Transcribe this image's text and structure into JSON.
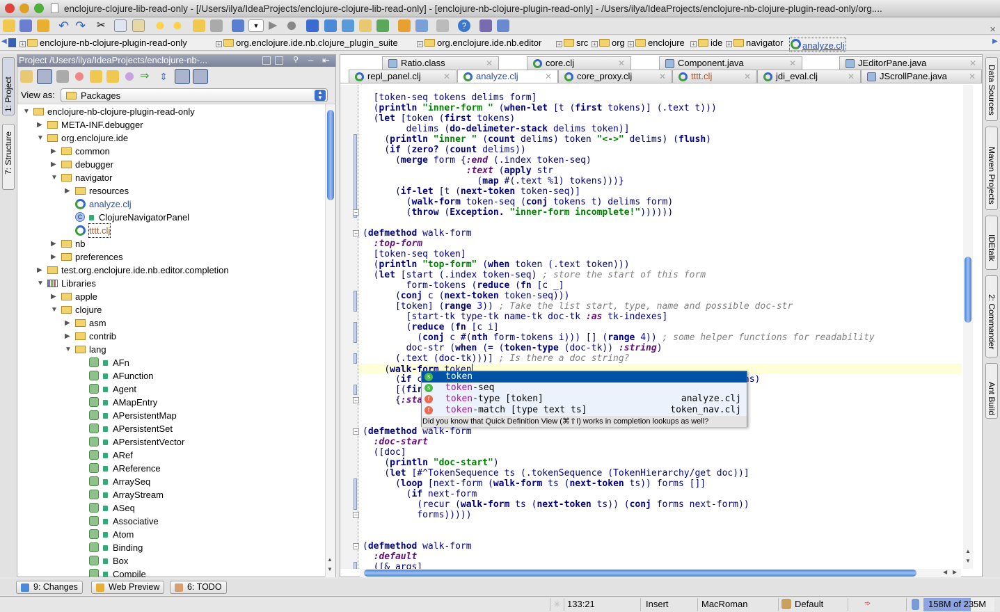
{
  "window": {
    "title": "enclojure-clojure-lib-read-only - [/Users/ilya/IdeaProjects/enclojure-clojure-lib-read-only] - [enclojure-nb-clojure-plugin-read-only] - /Users/ilya/IdeaProjects/enclojure-nb-clojure-plugin-read-only/org...."
  },
  "breadcrumbs": [
    "enclojure-nb-clojure-plugin-read-only",
    "org.enclojure.ide.nb.clojure_plugin_suite",
    "org.enclojure.ide.nb.editor",
    "src",
    "org",
    "enclojure",
    "ide",
    "navigator",
    "analyze.clj"
  ],
  "left_strip": {
    "project": "1: Project",
    "structure": "7: Structure"
  },
  "right_strip": [
    "Data Sources",
    "Maven Projects",
    "IDEtalk",
    "2: Commander",
    "Ant Build"
  ],
  "project": {
    "header": "Project /Users/ilya/IdeaProjects/enclojure-nb-...",
    "view_as_label": "View as:",
    "view_as_value": "Packages",
    "tree": [
      {
        "label": "enclojure-nb-clojure-plugin-read-only",
        "level": 0,
        "state": "expanded",
        "icon": "module-folder-icon"
      },
      {
        "label": "META-INF.debugger",
        "level": 1,
        "state": "collapsed",
        "icon": "package-icon"
      },
      {
        "label": "org.enclojure.ide",
        "level": 1,
        "state": "expanded",
        "icon": "package-icon"
      },
      {
        "label": "common",
        "level": 2,
        "state": "collapsed",
        "icon": "package-icon"
      },
      {
        "label": "debugger",
        "level": 2,
        "state": "collapsed",
        "icon": "package-icon"
      },
      {
        "label": "navigator",
        "level": 2,
        "state": "expanded",
        "icon": "package-icon"
      },
      {
        "label": "resources",
        "level": 3,
        "state": "collapsed",
        "icon": "package-icon"
      },
      {
        "label": "analyze.clj",
        "level": 3,
        "state": "leaf",
        "icon": "clojure-file-icon",
        "color": "#2a4fb0"
      },
      {
        "label": "ClojureNavigatorPanel",
        "level": 3,
        "state": "leaf",
        "icon": "class-icon"
      },
      {
        "label": "tttt.clj",
        "level": 3,
        "state": "leaf",
        "icon": "clojure-file-icon",
        "color": "#b0501a",
        "focused": true
      },
      {
        "label": "nb",
        "level": 2,
        "state": "collapsed",
        "icon": "package-icon"
      },
      {
        "label": "preferences",
        "level": 2,
        "state": "collapsed",
        "icon": "package-icon"
      },
      {
        "label": "test.org.enclojure.ide.nb.editor.completion",
        "level": 1,
        "state": "collapsed",
        "icon": "package-icon"
      },
      {
        "label": "Libraries",
        "level": 1,
        "state": "expanded",
        "icon": "libraries-icon"
      },
      {
        "label": "apple",
        "level": 2,
        "state": "collapsed",
        "icon": "package-icon"
      },
      {
        "label": "clojure",
        "level": 2,
        "state": "expanded",
        "icon": "package-icon"
      },
      {
        "label": "asm",
        "level": 3,
        "state": "collapsed",
        "icon": "package-icon"
      },
      {
        "label": "contrib",
        "level": 3,
        "state": "collapsed",
        "icon": "package-icon"
      },
      {
        "label": "lang",
        "level": 3,
        "state": "expanded",
        "icon": "package-icon"
      },
      {
        "label": "AFn",
        "level": 4,
        "state": "leaf",
        "icon": "compiled-class-icon"
      },
      {
        "label": "AFunction",
        "level": 4,
        "state": "leaf",
        "icon": "compiled-class-icon"
      },
      {
        "label": "Agent",
        "level": 4,
        "state": "leaf",
        "icon": "compiled-class-icon"
      },
      {
        "label": "AMapEntry",
        "level": 4,
        "state": "leaf",
        "icon": "compiled-class-icon"
      },
      {
        "label": "APersistentMap",
        "level": 4,
        "state": "leaf",
        "icon": "compiled-class-icon"
      },
      {
        "label": "APersistentSet",
        "level": 4,
        "state": "leaf",
        "icon": "compiled-class-icon"
      },
      {
        "label": "APersistentVector",
        "level": 4,
        "state": "leaf",
        "icon": "compiled-class-icon"
      },
      {
        "label": "ARef",
        "level": 4,
        "state": "leaf",
        "icon": "compiled-class-icon"
      },
      {
        "label": "AReference",
        "level": 4,
        "state": "leaf",
        "icon": "compiled-class-icon"
      },
      {
        "label": "ArraySeq",
        "level": 4,
        "state": "leaf",
        "icon": "compiled-class-icon"
      },
      {
        "label": "ArrayStream",
        "level": 4,
        "state": "leaf",
        "icon": "compiled-class-icon"
      },
      {
        "label": "ASeq",
        "level": 4,
        "state": "leaf",
        "icon": "compiled-class-icon"
      },
      {
        "label": "Associative",
        "level": 4,
        "state": "leaf",
        "icon": "compiled-interface-icon"
      },
      {
        "label": "Atom",
        "level": 4,
        "state": "leaf",
        "icon": "compiled-class-icon"
      },
      {
        "label": "Binding",
        "level": 4,
        "state": "leaf",
        "icon": "compiled-class-icon"
      },
      {
        "label": "Box",
        "level": 4,
        "state": "leaf",
        "icon": "compiled-class-icon"
      },
      {
        "label": "Compile",
        "level": 4,
        "state": "leaf",
        "icon": "compiled-class-icon"
      }
    ]
  },
  "editor": {
    "tabs_row1": [
      {
        "label": "Ratio.class",
        "icon": "class-file-icon"
      },
      {
        "label": "core.clj",
        "icon": "clojure-file-icon"
      },
      {
        "label": "Component.java",
        "icon": "java-file-icon"
      },
      {
        "label": "JEditorPane.java",
        "icon": "java-file-icon"
      }
    ],
    "tabs_row2": [
      {
        "label": "repl_panel.clj",
        "icon": "clojure-file-icon"
      },
      {
        "label": "analyze.clj",
        "icon": "clojure-file-icon",
        "active": true
      },
      {
        "label": "core_proxy.clj",
        "icon": "clojure-file-icon"
      },
      {
        "label": "tttt.clj",
        "icon": "clojure-file-icon",
        "color": "#b0501a"
      },
      {
        "label": "jdi_eval.clj",
        "icon": "clojure-file-icon"
      },
      {
        "label": "JScrollPane.java",
        "icon": "java-file-icon"
      }
    ],
    "current_line": 26,
    "lines": [
      [
        [
          "p",
          "  [token-seq tokens delims form]"
        ]
      ],
      [
        [
          "p",
          "  ("
        ],
        [
          "b",
          "println"
        ],
        [
          "p",
          " "
        ],
        [
          "s",
          "\"inner-form \""
        ],
        [
          "p",
          " ("
        ],
        [
          "b",
          "when-let"
        ],
        [
          "p",
          " [t ("
        ],
        [
          "b",
          "first"
        ],
        [
          "p",
          " tokens)] (.text t)))"
        ]
      ],
      [
        [
          "p",
          "  ("
        ],
        [
          "b",
          "let"
        ],
        [
          "p",
          " [token ("
        ],
        [
          "b",
          "first"
        ],
        [
          "p",
          " tokens)"
        ]
      ],
      [
        [
          "p",
          "        delims ("
        ],
        [
          "b",
          "do-delimeter-stack"
        ],
        [
          "p",
          " delims token)]"
        ]
      ],
      [
        [
          "p",
          "    ("
        ],
        [
          "b",
          "println"
        ],
        [
          "p",
          " "
        ],
        [
          "s",
          "\"inner \""
        ],
        [
          "p",
          " ("
        ],
        [
          "b",
          "count"
        ],
        [
          "p",
          " delims) token "
        ],
        [
          "s",
          "\"<->\""
        ],
        [
          "p",
          " delims) ("
        ],
        [
          "b",
          "flush"
        ],
        [
          "p",
          ")"
        ]
      ],
      [
        [
          "p",
          "    ("
        ],
        [
          "b",
          "if"
        ],
        [
          "p",
          " ("
        ],
        [
          "b",
          "zero?"
        ],
        [
          "p",
          " ("
        ],
        [
          "b",
          "count"
        ],
        [
          "p",
          " delims))"
        ]
      ],
      [
        [
          "p",
          "      ("
        ],
        [
          "b",
          "merge"
        ],
        [
          "p",
          " form {"
        ],
        [
          "k",
          ":end"
        ],
        [
          "p",
          " (.index token-seq)"
        ]
      ],
      [
        [
          "p",
          "                   "
        ],
        [
          "k",
          ":text"
        ],
        [
          "p",
          " ("
        ],
        [
          "b",
          "apply"
        ],
        [
          "p",
          " str"
        ]
      ],
      [
        [
          "p",
          "                     ("
        ],
        [
          "b",
          "map"
        ],
        [
          "p",
          " #(.text %1) tokens)))}"
        ]
      ],
      [
        [
          "p",
          "      ("
        ],
        [
          "b",
          "if-let"
        ],
        [
          "p",
          " [t ("
        ],
        [
          "b",
          "next-token"
        ],
        [
          "p",
          " token-seq)]"
        ]
      ],
      [
        [
          "p",
          "        ("
        ],
        [
          "b",
          "walk-form"
        ],
        [
          "p",
          " token-seq ("
        ],
        [
          "b",
          "conj"
        ],
        [
          "p",
          " tokens t) delims form)"
        ]
      ],
      [
        [
          "p",
          "        ("
        ],
        [
          "b",
          "throw"
        ],
        [
          "p",
          " ("
        ],
        [
          "b",
          "Exception."
        ],
        [
          "p",
          " "
        ],
        [
          "s",
          "\"inner-form incomplete!\""
        ],
        [
          "p",
          "))))))"
        ]
      ],
      [],
      [
        [
          "p",
          "("
        ],
        [
          "b",
          "defmethod"
        ],
        [
          "p",
          " walk-form"
        ]
      ],
      [
        [
          "p",
          "  "
        ],
        [
          "k",
          ":top-form"
        ]
      ],
      [
        [
          "p",
          "  [token-seq token]"
        ]
      ],
      [
        [
          "p",
          "  ("
        ],
        [
          "b",
          "println"
        ],
        [
          "p",
          " "
        ],
        [
          "s",
          "\"top-form\""
        ],
        [
          "p",
          " ("
        ],
        [
          "b",
          "when"
        ],
        [
          "p",
          " token (.text token)))"
        ]
      ],
      [
        [
          "p",
          "  ("
        ],
        [
          "b",
          "let"
        ],
        [
          "p",
          " [start (.index token-seq) "
        ],
        [
          "c",
          "; store the start of this form"
        ]
      ],
      [
        [
          "p",
          "        form-tokens ("
        ],
        [
          "b",
          "reduce"
        ],
        [
          "p",
          " ("
        ],
        [
          "b",
          "fn"
        ],
        [
          "p",
          " [c _]"
        ]
      ],
      [
        [
          "p",
          "      ("
        ],
        [
          "b",
          "conj"
        ],
        [
          "p",
          " c ("
        ],
        [
          "b",
          "next-token"
        ],
        [
          "p",
          " token-seq)))"
        ]
      ],
      [
        [
          "p",
          "      [token] ("
        ],
        [
          "b",
          "range"
        ],
        [
          "p",
          " "
        ],
        [
          "n",
          "3"
        ],
        [
          "p",
          ")) "
        ],
        [
          "c",
          "; Take the list start, type, name and possible doc-str"
        ]
      ],
      [
        [
          "p",
          "        [start-tk type-tk name-tk doc-tk "
        ],
        [
          "k",
          ":as"
        ],
        [
          "p",
          " tk-indexes]"
        ]
      ],
      [
        [
          "p",
          "        ("
        ],
        [
          "b",
          "reduce"
        ],
        [
          "p",
          " ("
        ],
        [
          "b",
          "fn"
        ],
        [
          "p",
          " [c i]"
        ]
      ],
      [
        [
          "p",
          "          ("
        ],
        [
          "b",
          "conj"
        ],
        [
          "p",
          " c #("
        ],
        [
          "b",
          "nth"
        ],
        [
          "p",
          " form-tokens i))) [] ("
        ],
        [
          "b",
          "range"
        ],
        [
          "p",
          " "
        ],
        [
          "n",
          "4"
        ],
        [
          "p",
          ")) "
        ],
        [
          "c",
          "; some helper functions for readability"
        ]
      ],
      [
        [
          "p",
          "        doc-str ("
        ],
        [
          "b",
          "when"
        ],
        [
          "p",
          " ("
        ],
        [
          "b",
          "="
        ],
        [
          "p",
          " ("
        ],
        [
          "b",
          "token-type"
        ],
        [
          "p",
          " (doc-tk)) "
        ],
        [
          "k",
          ":string"
        ],
        [
          "p",
          ")"
        ]
      ],
      [
        [
          "p",
          "      (.text (doc-tk)))] "
        ],
        [
          "c",
          "; Is there a doc string?"
        ]
      ],
      [
        [
          "p",
          "    ("
        ],
        [
          "b",
          "walk-form"
        ],
        [
          "p",
          " token"
        ]
      ],
      [
        [
          "p",
          "      ("
        ],
        [
          "b",
          "if"
        ],
        [
          "p",
          " c                                                           ns)"
        ]
      ],
      [
        [
          "p",
          "      [("
        ],
        [
          "b",
          "fir"
        ]
      ],
      [
        [
          "p",
          "      {"
        ],
        [
          "k",
          ":sta"
        ]
      ],
      [],
      [],
      [
        [
          "p",
          "("
        ],
        [
          "b",
          "defmethod"
        ],
        [
          "p",
          " walk-form"
        ]
      ],
      [
        [
          "p",
          "  "
        ],
        [
          "k",
          ":doc-start"
        ]
      ],
      [
        [
          "p",
          "  ([doc]"
        ]
      ],
      [
        [
          "p",
          "    ("
        ],
        [
          "b",
          "println"
        ],
        [
          "p",
          " "
        ],
        [
          "s",
          "\"doc-start\""
        ],
        [
          "p",
          ")"
        ]
      ],
      [
        [
          "p",
          "    ("
        ],
        [
          "b",
          "let"
        ],
        [
          "p",
          " [#^TokenSequence ts (.tokenSequence (TokenHierarchy/get doc))]"
        ]
      ],
      [
        [
          "p",
          "      ("
        ],
        [
          "b",
          "loop"
        ],
        [
          "p",
          " [next-form ("
        ],
        [
          "b",
          "walk-form"
        ],
        [
          "p",
          " ts ("
        ],
        [
          "b",
          "next-token"
        ],
        [
          "p",
          " ts)) forms []]"
        ]
      ],
      [
        [
          "p",
          "        ("
        ],
        [
          "b",
          "if"
        ],
        [
          "p",
          " next-form"
        ]
      ],
      [
        [
          "p",
          "          (recur ("
        ],
        [
          "b",
          "walk-form"
        ],
        [
          "p",
          " ts ("
        ],
        [
          "b",
          "next-token"
        ],
        [
          "p",
          " ts)) ("
        ],
        [
          "b",
          "conj"
        ],
        [
          "p",
          " forms next-form))"
        ]
      ],
      [
        [
          "p",
          "          forms)))))"
        ]
      ],
      [],
      [],
      [
        [
          "p",
          "("
        ],
        [
          "b",
          "defmethod"
        ],
        [
          "p",
          " walk-form"
        ]
      ],
      [
        [
          "p",
          "  "
        ],
        [
          "k",
          ":default"
        ]
      ],
      [
        [
          "p",
          "  ([& args]"
        ]
      ]
    ],
    "completion": {
      "prefix": "token",
      "items": [
        {
          "match": "token",
          "rest": "",
          "params": "",
          "location": "",
          "kind": "s",
          "selected": true
        },
        {
          "match": "token",
          "rest": "-seq",
          "params": "",
          "location": "",
          "kind": "s"
        },
        {
          "match": "token",
          "rest": "-type",
          "params": " [token]",
          "location": "analyze.clj",
          "kind": "f"
        },
        {
          "match": "token",
          "rest": "-match",
          "params": " [type text ts]",
          "location": "token_nav.clj",
          "kind": "f"
        }
      ],
      "hint": "Did you know that Quick Definition View (⌘⇧I) works in completion lookups as well?"
    }
  },
  "bottom_tools": [
    "9: Changes",
    "Web Preview",
    "6: TODO"
  ],
  "status": {
    "position": "133:21",
    "mode": "Insert",
    "encoding": "MacRoman",
    "scheme": "Default",
    "memory": "158M of 235M",
    "memory_used_fraction": 0.67
  },
  "colors": {
    "selection": "#0052a4",
    "keyword": "#000080",
    "string": "#008000",
    "clj_keyword": "#660e7a",
    "comment": "#808080",
    "current_line": "#ffffd7"
  }
}
